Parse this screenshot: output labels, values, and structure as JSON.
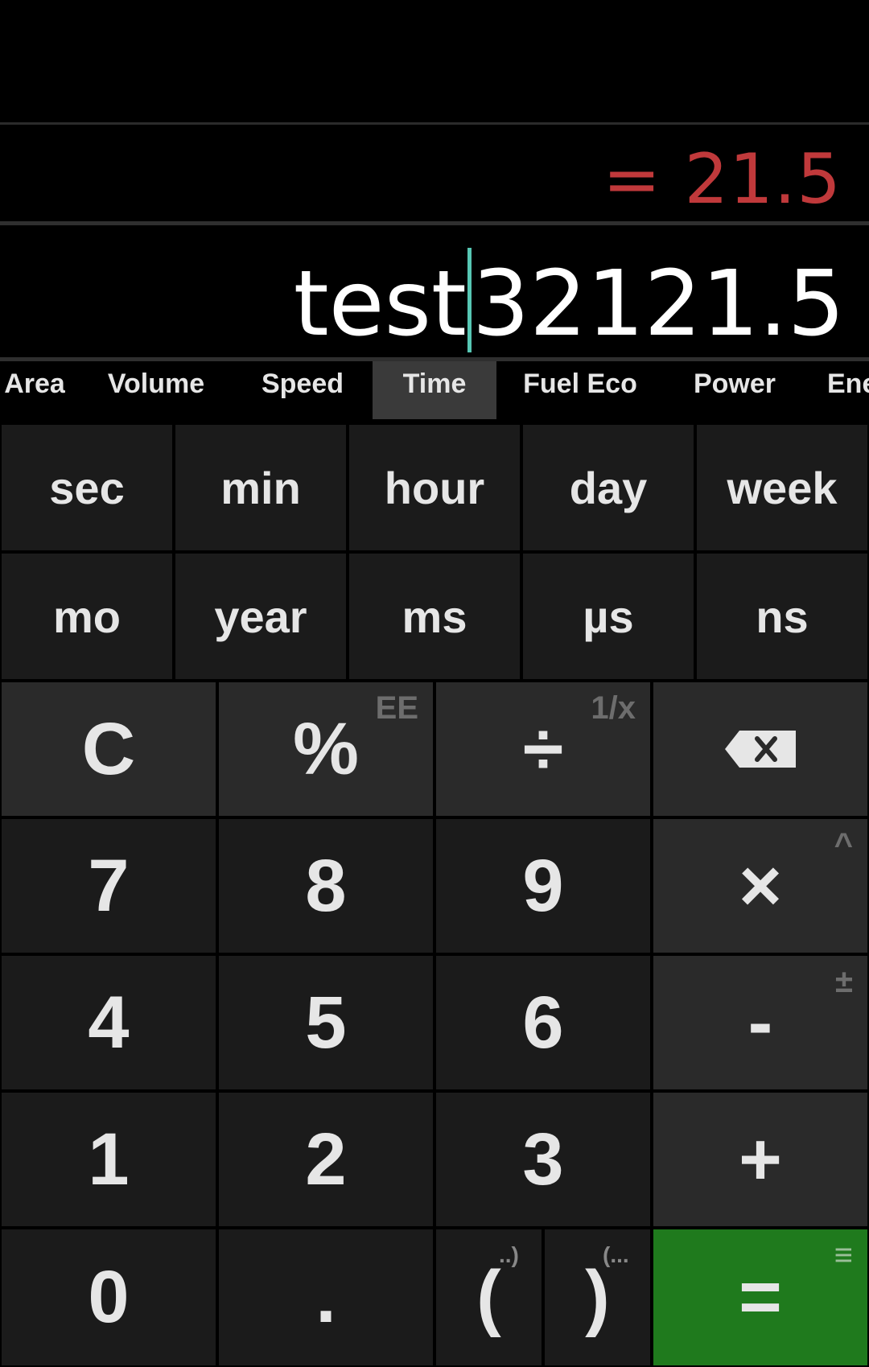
{
  "display": {
    "result": "= 21.5",
    "expression_left": "test",
    "expression_right": "32121.5"
  },
  "tabs": [
    "Area",
    "Volume",
    "Speed",
    "Time",
    "Fuel Eco",
    "Power",
    "Ene"
  ],
  "active_tab": "Time",
  "units_row1": [
    "sec",
    "min",
    "hour",
    "day",
    "week"
  ],
  "units_row2": [
    "mo",
    "year",
    "ms",
    "µs",
    "ns"
  ],
  "keys": {
    "clear": "C",
    "percent": "%",
    "percent_alt": "EE",
    "divide": "÷",
    "divide_alt": "1/x",
    "seven": "7",
    "eight": "8",
    "nine": "9",
    "multiply": "×",
    "multiply_alt": "^",
    "four": "4",
    "five": "5",
    "six": "6",
    "minus": "-",
    "minus_alt": "±",
    "one": "1",
    "two": "2",
    "three": "3",
    "plus": "+",
    "zero": "0",
    "dot": ".",
    "open_paren": "(",
    "open_paren_alt": "..)",
    "close_paren": ")",
    "close_paren_alt": "(...",
    "equals": "=",
    "equals_alt": "≡"
  },
  "colors": {
    "result": "#c0393b",
    "cursor": "#57c7b4",
    "equals_bg": "#1f7a1d",
    "key_bg": "#1b1b1b",
    "op_bg": "#2a2a2a"
  }
}
